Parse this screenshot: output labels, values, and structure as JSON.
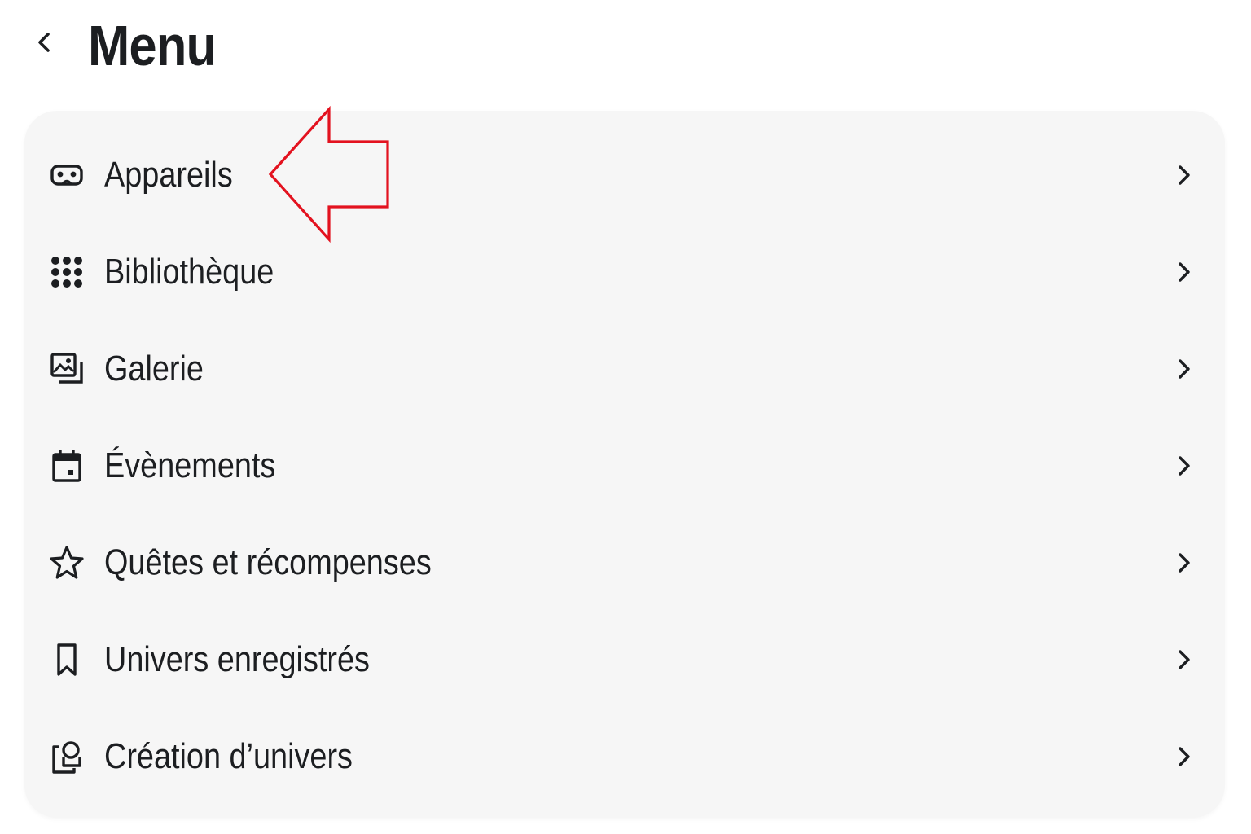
{
  "header": {
    "back_icon": "chevron-left-icon",
    "title": "Menu"
  },
  "menu": {
    "items": [
      {
        "label": "Appareils",
        "icon": "vr-headset-icon"
      },
      {
        "label": "Bibliothèque",
        "icon": "grid-dots-icon"
      },
      {
        "label": "Galerie",
        "icon": "gallery-icon"
      },
      {
        "label": "Évènements",
        "icon": "calendar-icon"
      },
      {
        "label": "Quêtes et récompenses",
        "icon": "star-icon"
      },
      {
        "label": "Univers enregistrés",
        "icon": "bookmark-icon"
      },
      {
        "label": "Création d’univers",
        "icon": "world-creation-icon"
      }
    ],
    "chevron_icon": "chevron-right-icon"
  },
  "annotation": {
    "icon": "red-arrow-left",
    "color": "#e3121f",
    "points_to": "Appareils"
  },
  "colors": {
    "background": "#ffffff",
    "card": "#f6f6f6",
    "text": "#1c1e21"
  }
}
